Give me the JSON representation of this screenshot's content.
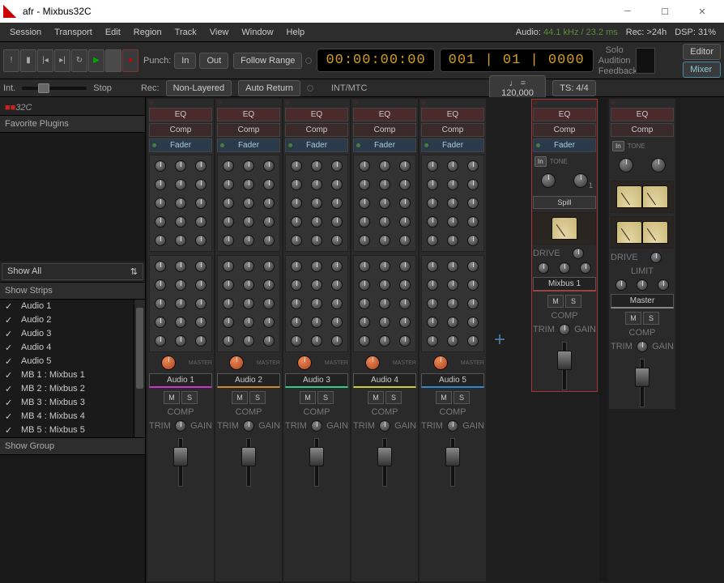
{
  "window": {
    "title": "afr - Mixbus32C"
  },
  "menu": {
    "items": [
      "Session",
      "Transport",
      "Edit",
      "Region",
      "Track",
      "View",
      "Window",
      "Help"
    ]
  },
  "status_bar": {
    "audio_label": "Audio:",
    "audio_value": "44.1 kHz / 23.2 ms",
    "rec_label": "Rec:",
    "rec_value": ">24h",
    "dsp_label": "DSP:",
    "dsp_value": "31%"
  },
  "transport": {
    "punch_label": "Punch:",
    "in": "In",
    "out": "Out",
    "follow_range": "Follow Range",
    "rec_label": "Rec:",
    "non_layered": "Non-Layered",
    "auto_return": "Auto Return",
    "timecode": "00:00:00:00",
    "bbt": "001 | 01 | 0000",
    "int_mtc": "INT/MTC",
    "int_label": "Int.",
    "stop_label": "Stop",
    "tempo": "♩ = 120,000",
    "ts": "TS: 4/4"
  },
  "status_col": {
    "solo": "Solo",
    "audition": "Audition",
    "feedback": "Feedback"
  },
  "right_buttons": {
    "editor": "Editor",
    "mixer": "Mixer"
  },
  "sidebar": {
    "logo_text": "32C",
    "fav_header": "Favorite Plugins",
    "show_all": "Show All",
    "strips_header": "Show  Strips",
    "group_header": "Show  Group",
    "strips": [
      {
        "label": "Audio  1"
      },
      {
        "label": "Audio  2"
      },
      {
        "label": "Audio  3"
      },
      {
        "label": "Audio  4"
      },
      {
        "label": "Audio  5"
      },
      {
        "label": "MB 1 : Mixbus 1"
      },
      {
        "label": "MB 2 : Mixbus 2"
      },
      {
        "label": "MB 3 : Mixbus 3"
      },
      {
        "label": "MB 4 : Mixbus 4"
      },
      {
        "label": "MB 5 : Mixbus 5"
      }
    ]
  },
  "sections": {
    "eq": "EQ",
    "comp": "Comp",
    "fader": "Fader"
  },
  "channels": [
    {
      "name": "Audio 1"
    },
    {
      "name": "Audio 2"
    },
    {
      "name": "Audio 3"
    },
    {
      "name": "Audio 4"
    },
    {
      "name": "Audio 5"
    }
  ],
  "bus": {
    "name": "Mixbus 1",
    "spill": "Spill",
    "in": "In",
    "tone": "TONE"
  },
  "master": {
    "name": "Master",
    "limit": "LIMIT"
  },
  "btns": {
    "m": "M",
    "s": "S"
  },
  "tiny": {
    "master": "MASTER",
    "comp": "COMP",
    "trim": "TRIM",
    "gain": "GAIN",
    "drive": "DRIVE"
  }
}
